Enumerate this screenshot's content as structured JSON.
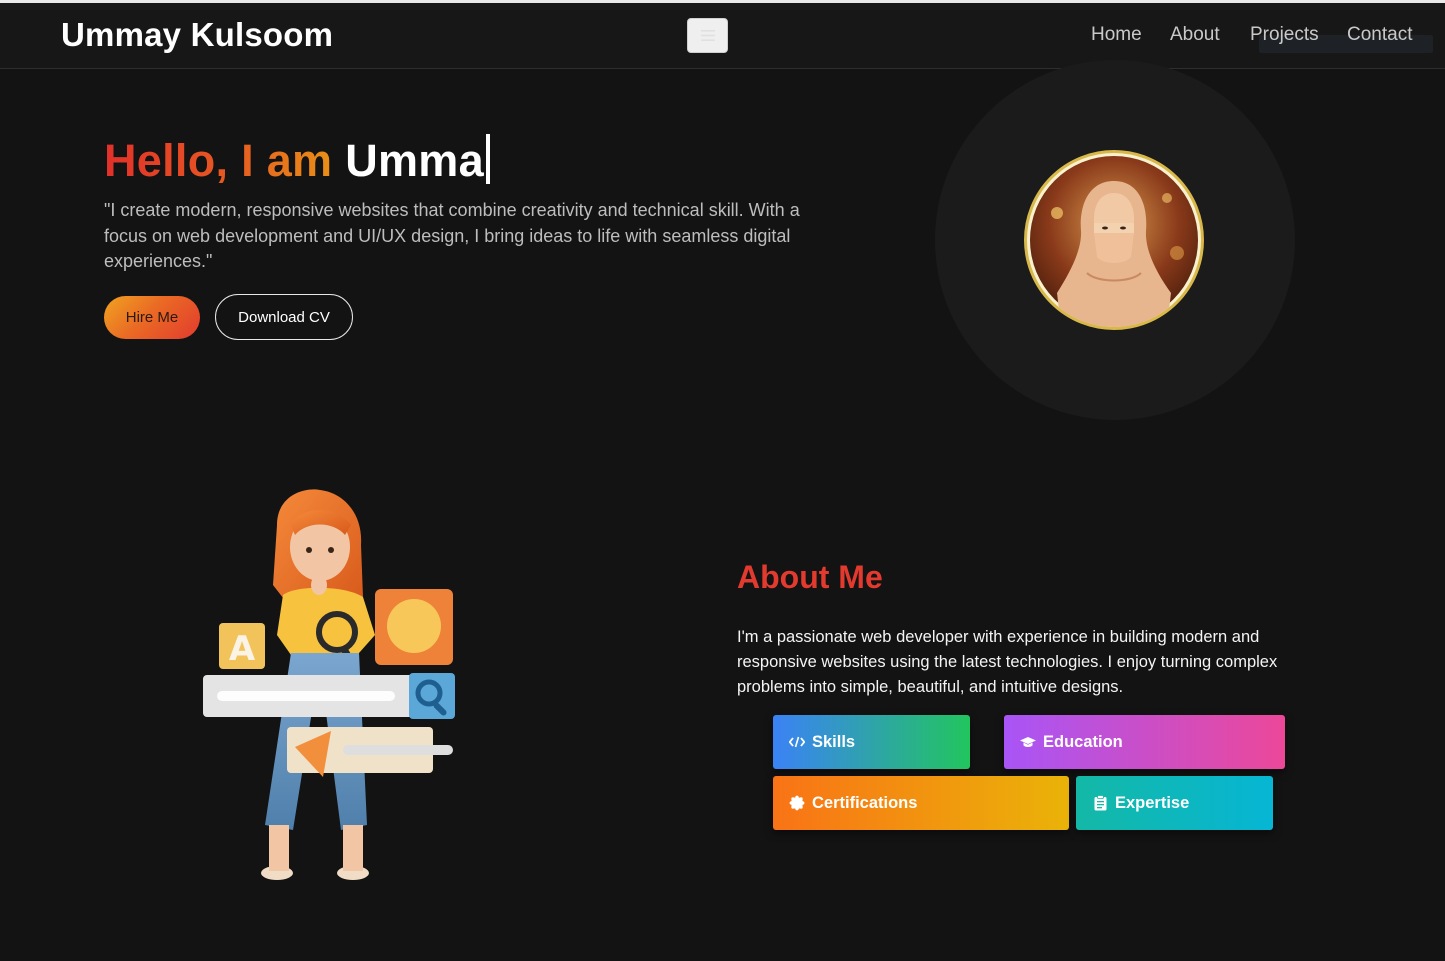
{
  "navbar": {
    "brand": "Ummay Kulsoom",
    "toggle_icon": "hamburger-icon",
    "links": [
      {
        "label": "Home"
      },
      {
        "label": "About"
      },
      {
        "label": "Projects"
      },
      {
        "label": "Contact"
      }
    ]
  },
  "hero": {
    "greeting": "Hello, I am",
    "typed_name": "Umma",
    "tagline": "\"I create modern, responsive websites that combine creativity and technical skill. With a focus on web development and UI/UX design, I bring ideas to life with seamless digital experiences.\"",
    "hire_label": "Hire Me",
    "cv_label": "Download CV"
  },
  "about": {
    "heading": "About Me",
    "text": "I'm a passionate web developer with experience in building modern and responsive websites using the latest technologies. I enjoy turning complex problems into simple, beautiful, and intuitive designs.",
    "cards": [
      {
        "label": "Skills",
        "icon": "code-icon"
      },
      {
        "label": "Education",
        "icon": "graduation-cap-icon"
      },
      {
        "label": "Certifications",
        "icon": "badge-icon"
      },
      {
        "label": "Expertise",
        "icon": "clipboard-icon"
      }
    ]
  },
  "colors": {
    "background": "#131313",
    "accent_red": "#e23a2e",
    "accent_orange": "#e98f17"
  }
}
